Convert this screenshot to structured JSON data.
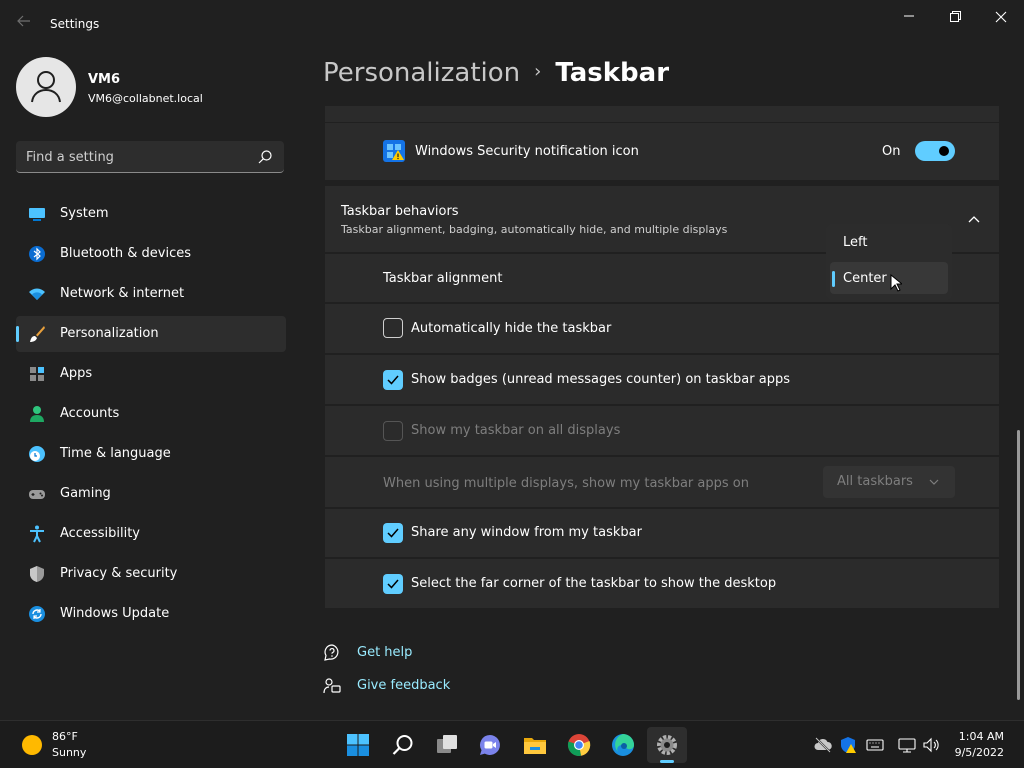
{
  "window": {
    "title": "Settings"
  },
  "profile": {
    "name": "VM6",
    "email": "VM6@collabnet.local"
  },
  "search": {
    "placeholder": "Find a setting"
  },
  "sidebar": {
    "items": [
      {
        "label": "System",
        "icon": "system-icon"
      },
      {
        "label": "Bluetooth & devices",
        "icon": "bluetooth-icon"
      },
      {
        "label": "Network & internet",
        "icon": "wifi-icon"
      },
      {
        "label": "Personalization",
        "icon": "brush-icon",
        "selected": true
      },
      {
        "label": "Apps",
        "icon": "apps-icon"
      },
      {
        "label": "Accounts",
        "icon": "person-icon"
      },
      {
        "label": "Time & language",
        "icon": "clock-globe-icon"
      },
      {
        "label": "Gaming",
        "icon": "gamepad-icon"
      },
      {
        "label": "Accessibility",
        "icon": "accessibility-icon"
      },
      {
        "label": "Privacy & security",
        "icon": "shield-icon"
      },
      {
        "label": "Windows Update",
        "icon": "update-icon"
      }
    ]
  },
  "breadcrumb": {
    "parent": "Personalization",
    "separator": "›",
    "current": "Taskbar"
  },
  "security_row": {
    "label": "Windows Security notification icon",
    "state_text": "On",
    "toggle_on": true
  },
  "behaviors": {
    "title": "Taskbar behaviors",
    "subtitle": "Taskbar alignment, badging, automatically hide, and multiple displays",
    "expanded": true,
    "alignment_label": "Taskbar alignment",
    "alignment_options": [
      "Left",
      "Center"
    ],
    "alignment_selected": "Center",
    "auto_hide": {
      "label": "Automatically hide the taskbar",
      "checked": false
    },
    "badges": {
      "label": "Show badges (unread messages counter) on taskbar apps",
      "checked": true
    },
    "all_displays": {
      "label": "Show my taskbar on all displays",
      "checked": false,
      "disabled": true
    },
    "multi_display": {
      "label": "When using multiple displays, show my taskbar apps on",
      "value": "All taskbars",
      "disabled": true
    },
    "share_window": {
      "label": "Share any window from my taskbar",
      "checked": true
    },
    "far_corner": {
      "label": "Select the far corner of the taskbar to show the desktop",
      "checked": true
    }
  },
  "help": {
    "get_help": "Get help",
    "give_feedback": "Give feedback"
  },
  "taskbar": {
    "weather": {
      "temp": "86°F",
      "condition": "Sunny"
    },
    "apps": [
      "start-icon",
      "search-icon",
      "task-view-icon",
      "chat-icon",
      "file-explorer-icon",
      "chrome-icon",
      "edge-icon",
      "settings-icon"
    ],
    "clock": {
      "time": "1:04 AM",
      "date": "9/5/2022"
    }
  },
  "colors": {
    "accent": "#60cdff",
    "background": "#202020",
    "card": "#2b2b2b",
    "link": "#99ebff"
  }
}
